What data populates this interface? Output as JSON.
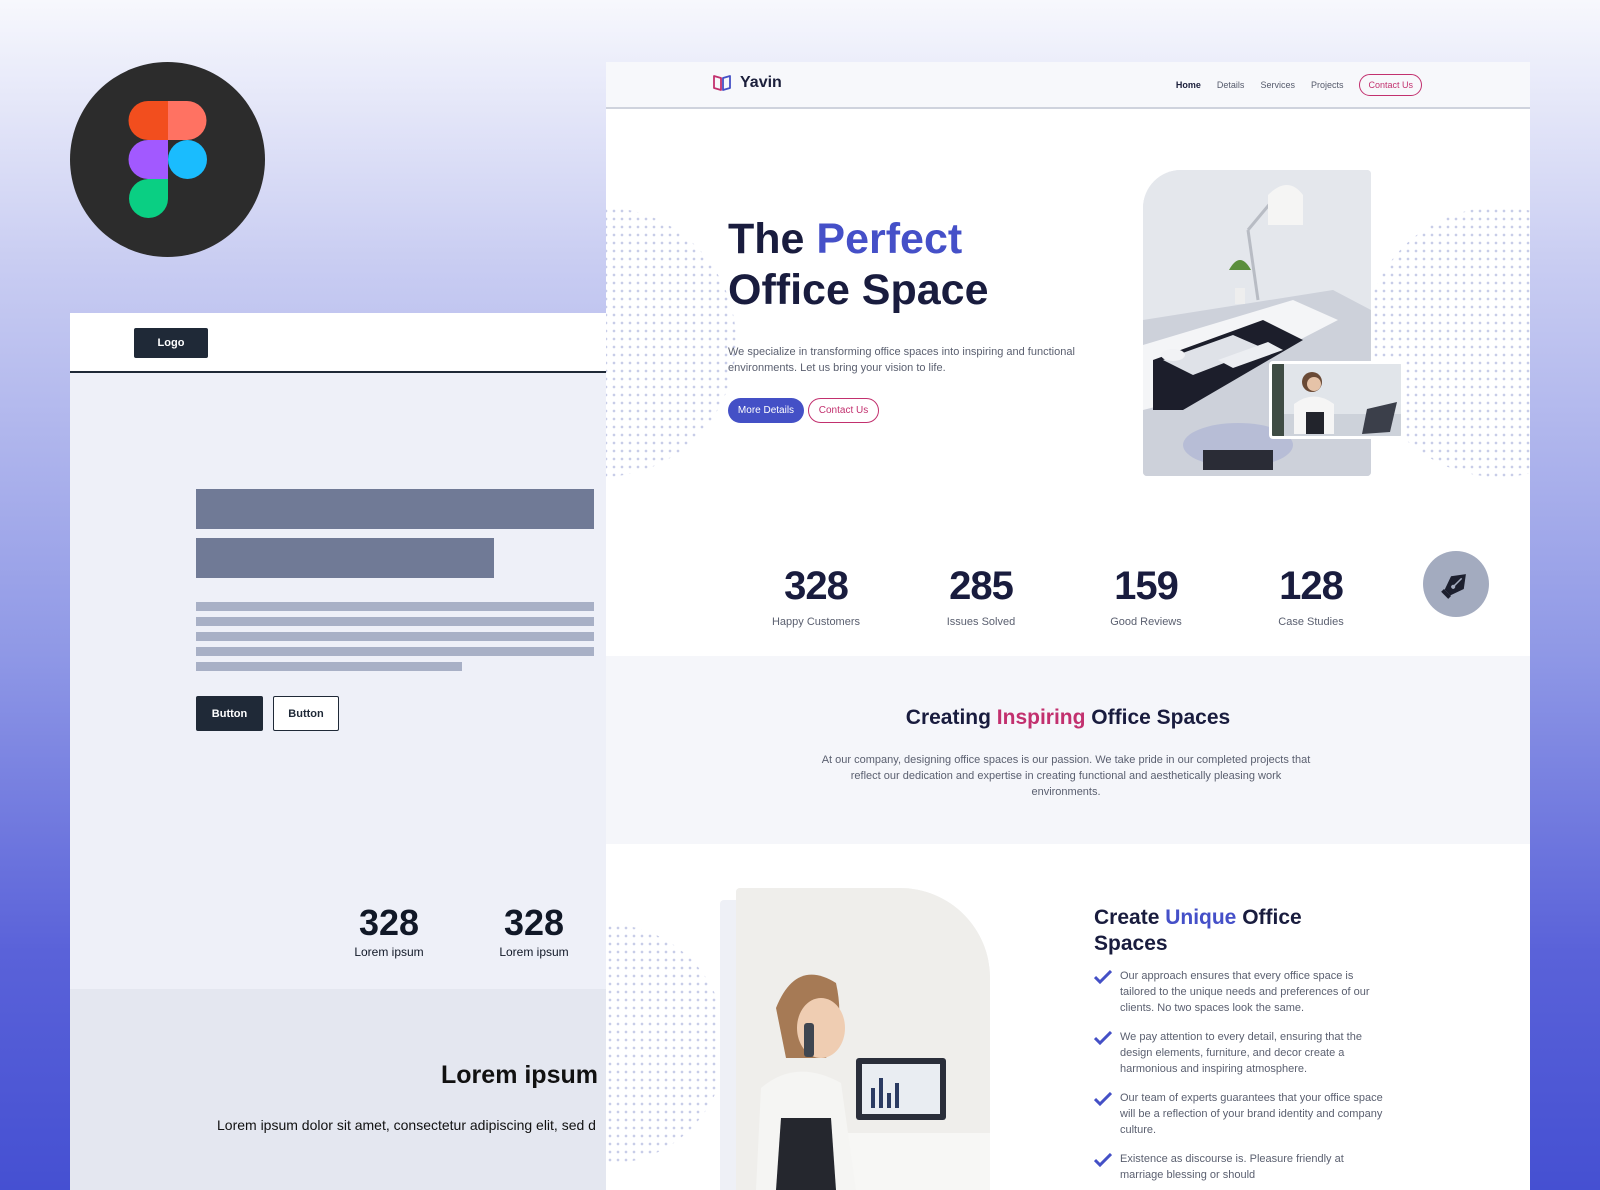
{
  "colors": {
    "primary": "#4450c6",
    "accent_pink": "#c2306e",
    "heading": "#191c3e",
    "wire_dark": "#1f2937"
  },
  "wireframe": {
    "logo_label": "Logo",
    "button_primary": "Button",
    "button_secondary": "Button",
    "stats": [
      {
        "value": "328",
        "label": "Lorem ipsum"
      },
      {
        "value": "328",
        "label": "Lorem ipsum"
      }
    ],
    "section_title": "Lorem ipsum",
    "section_text": "Lorem ipsum dolor sit amet, consectetur adipiscing elit, sed d"
  },
  "site": {
    "brand": "Yavin",
    "nav": {
      "items": [
        "Home",
        "Details",
        "Services",
        "Projects"
      ],
      "active": "Home",
      "contact_button": "Contact Us"
    },
    "hero": {
      "title_part1": "The ",
      "title_accent": "Perfect",
      "title_line2": "Office Space",
      "description": "We specialize in transforming office spaces into inspiring and functional environments. Let us bring your vision to life.",
      "primary_button": "More Details",
      "secondary_button": "Contact Us"
    },
    "stats": [
      {
        "value": "328",
        "label": "Happy Customers"
      },
      {
        "value": "285",
        "label": "Issues Solved"
      },
      {
        "value": "159",
        "label": "Good Reviews"
      },
      {
        "value": "128",
        "label": "Case Studies"
      }
    ],
    "section2": {
      "title_part1": "Creating ",
      "title_accent": "Inspiring",
      "title_part2": " Office Spaces",
      "text": "At our company, designing office spaces is our passion. We take pride in our completed projects that reflect our dedication and expertise in creating functional and aesthetically pleasing work environments."
    },
    "section3": {
      "title_part1": "Create ",
      "title_accent": "Unique",
      "title_part2": " Office Spaces",
      "items": [
        "Our approach ensures that every office space is tailored to the unique needs and preferences of our clients. No two spaces look the same.",
        "We pay attention to every detail, ensuring that the design elements, furniture, and decor create a harmonious and inspiring atmosphere.",
        "Our team of experts guarantees that your office space will be a reflection of your brand identity and company culture.",
        "Existence as discourse is. Pleasure friendly at marriage blessing or should"
      ]
    }
  }
}
